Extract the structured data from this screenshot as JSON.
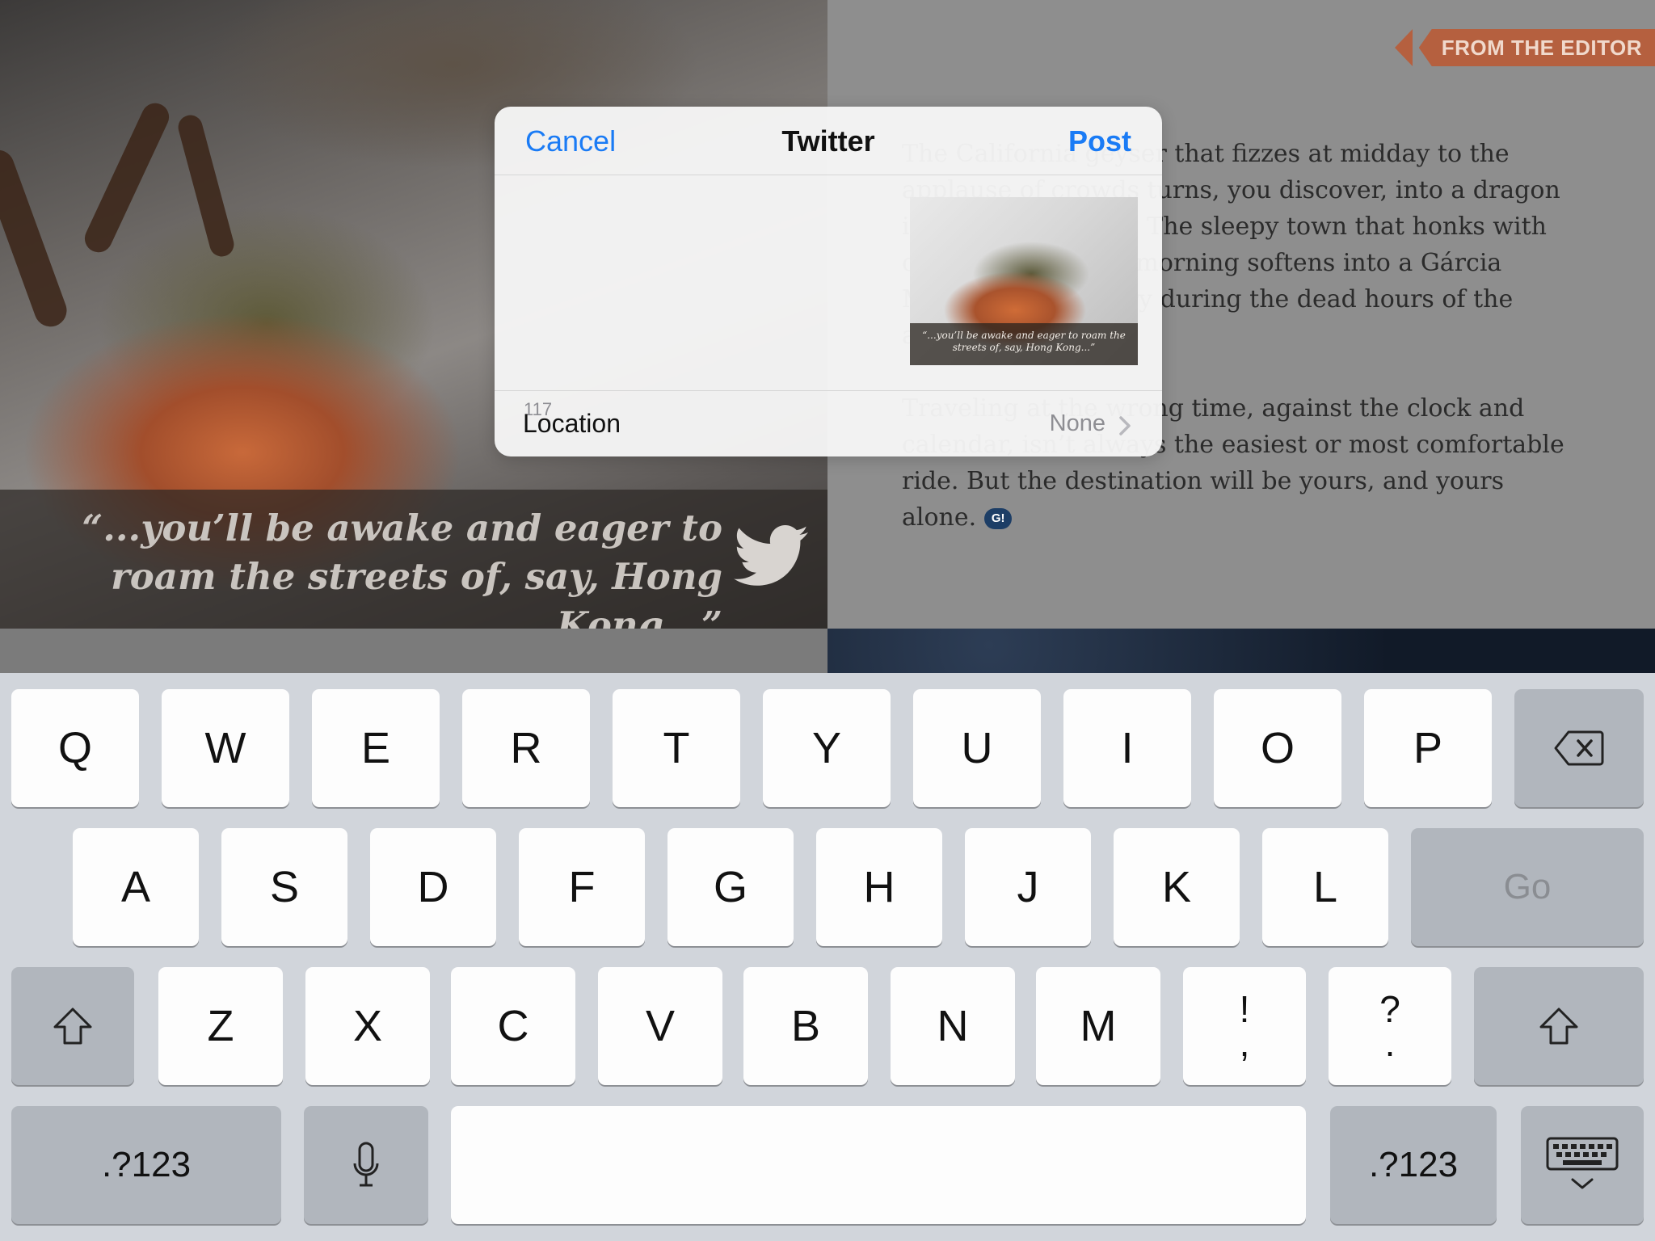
{
  "background": {
    "photo_quote": "“...you’ll be awake and eager to roam the streets of, say, Hong Kong...”",
    "article_badge": "FROM THE EDITOR",
    "article_paragraph_1": "The California geyser that fizzes at midday to the applause of crowds turns, you discover, into a dragon in moonlit solitude. The sleepy town that honks with cars and bustle all morning softens into a Gárcia Márquez short story during the dead hours of the afternoon siesta.",
    "article_paragraph_2": "Traveling at the wrong time, against the clock and calendar, isn’t always the easiest or most comfortable ride. But the destination will be yours, and yours alone.",
    "end_badge": "G!"
  },
  "share_sheet": {
    "title": "Twitter",
    "cancel_label": "Cancel",
    "post_label": "Post",
    "compose_value": "",
    "char_count": "117",
    "attachment_caption": "“...you’ll be awake and eager to roam the streets of, say, Hong Kong...”",
    "location_label": "Location",
    "location_value": "None"
  },
  "keyboard": {
    "row1": [
      "Q",
      "W",
      "E",
      "R",
      "T",
      "Y",
      "U",
      "I",
      "O",
      "P"
    ],
    "row2": [
      "A",
      "S",
      "D",
      "F",
      "G",
      "H",
      "J",
      "K",
      "L"
    ],
    "row3": [
      "Z",
      "X",
      "C",
      "V",
      "B",
      "N",
      "M"
    ],
    "punct1_top": "!",
    "punct1_bottom": ",",
    "punct2_top": "?",
    "punct2_bottom": ".",
    "go_label": "Go",
    "numbers_label": ".?123"
  }
}
